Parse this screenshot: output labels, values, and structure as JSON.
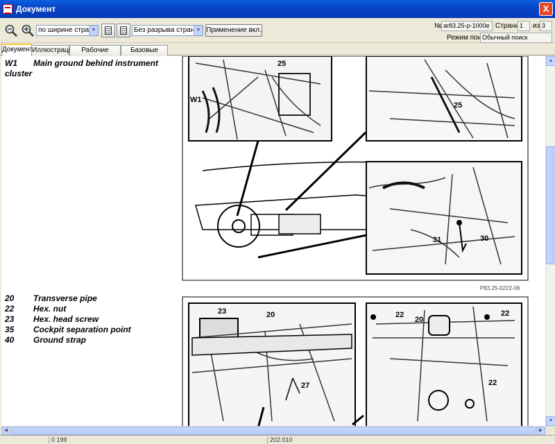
{
  "window": {
    "title": "Документ",
    "close_label": "X"
  },
  "toolbar": {
    "zoom_out_icon": "zoom-out-icon",
    "zoom_in_icon": "zoom-in-icon",
    "zoom_mode": "по ширине страницы",
    "page_break_mode": "Без разрыва страниц",
    "apply_label": "Применение вкл.",
    "doc_no_label": "№",
    "doc_no_value": "ar83.25-p-1000e",
    "page_label": "Страница",
    "page_value": "1",
    "of_label": "из",
    "page_total": "3",
    "search_mode_label": "Режим поиска",
    "search_mode_value": "Обычный поиск"
  },
  "tabs": [
    {
      "label": "Документ",
      "active": true
    },
    {
      "label": "Иллюстрация",
      "active": false
    },
    {
      "label": "Рабочие операции",
      "active": false
    },
    {
      "label": "Базовые данные",
      "active": false
    }
  ],
  "document": {
    "legend_top": [
      {
        "code": "W1",
        "text": "Main ground behind instrument"
      },
      {
        "code": "",
        "text": "cluster"
      }
    ],
    "legend_bottom": [
      {
        "code": "20",
        "text": "Transverse pipe"
      },
      {
        "code": "22",
        "text": "Hex. nut"
      },
      {
        "code": "23",
        "text": "Hex. head screw"
      },
      {
        "code": "35",
        "text": "Cockpit separation point"
      },
      {
        "code": "40",
        "text": "Ground strap"
      }
    ],
    "figure1_caption": "P83.25-0222-06",
    "figure1_callouts": [
      "25",
      "W1",
      "25",
      "31",
      "30"
    ],
    "figure2_callouts": [
      "23",
      "20",
      "27",
      "22",
      "20",
      "22",
      "22"
    ]
  },
  "statusbar": {
    "cells": [
      "0 199",
      "202.010"
    ]
  }
}
